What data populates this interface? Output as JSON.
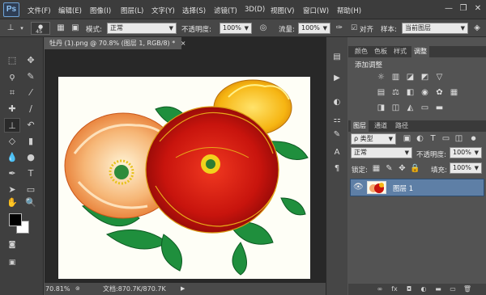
{
  "app": {
    "logo": "Ps"
  },
  "menu": [
    "文件(F)",
    "编辑(E)",
    "图像(I)",
    "图层(L)",
    "文字(Y)",
    "选择(S)",
    "滤镜(T)",
    "3D(D)",
    "视图(V)",
    "窗口(W)",
    "帮助(H)"
  ],
  "window_controls": {
    "minimize": "—",
    "restore": "❐",
    "close": "✕"
  },
  "options": {
    "brush_size": "45",
    "mode_label": "模式:",
    "mode_value": "正常",
    "opacity_label": "不透明度:",
    "opacity_value": "100%",
    "flow_label": "流量:",
    "flow_value": "100%",
    "align_label": "对齐",
    "sample_label": "样本:",
    "sample_value": "当前图层"
  },
  "document": {
    "tab_title": "牡丹 (1).png @ 70.8% (图层 1, RGB/8) *",
    "tab_close": "×",
    "zoom": "70.81%",
    "doc_info": "文档:870.7K/870.7K"
  },
  "panels": {
    "top_tabs": [
      "颜色",
      "色板",
      "样式",
      "调整"
    ],
    "adjust_title": "添加调整",
    "layer_tabs": [
      "图层",
      "通道",
      "路径"
    ],
    "kind_label": "ρ 类型",
    "blend_mode": "正常",
    "opacity_label": "不透明度:",
    "opacity_value": "100%",
    "lock_label": "锁定:",
    "fill_label": "填充:",
    "fill_value": "100%",
    "layer_name": "图层 1",
    "bottom_icons": [
      "∞",
      "fx",
      "◘",
      "◐",
      "▬",
      "▭",
      "🗑"
    ]
  },
  "colors": {
    "foreground": "#000000",
    "background": "#ffffff",
    "accent": "#5e7fa6"
  }
}
